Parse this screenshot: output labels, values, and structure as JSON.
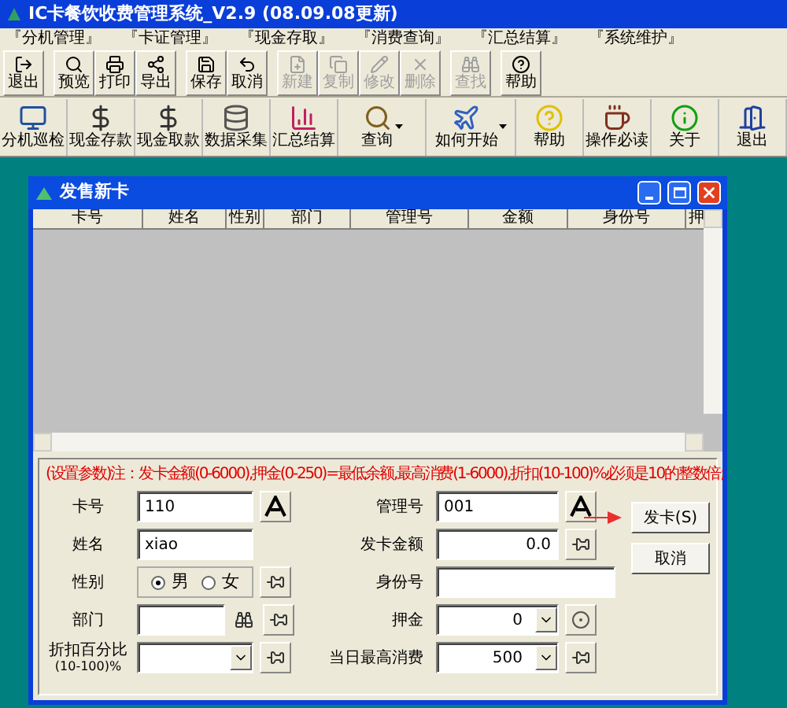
{
  "window": {
    "title": "IC卡餐饮收费管理系统_V2.9 (08.09.08更新)"
  },
  "menu": [
    "『分机管理』",
    "『卡证管理』",
    "『现金存取』",
    "『消费查询』",
    "『汇总结算』",
    "『系统维护』"
  ],
  "toolbar": [
    {
      "label": "退出",
      "disabled": false
    },
    {
      "label": "预览",
      "disabled": false
    },
    {
      "label": "打印",
      "disabled": false
    },
    {
      "label": "导出",
      "disabled": false
    },
    {
      "label": "保存",
      "disabled": false
    },
    {
      "label": "取消",
      "disabled": false
    },
    {
      "label": "新建",
      "disabled": true
    },
    {
      "label": "复制",
      "disabled": true
    },
    {
      "label": "修改",
      "disabled": true
    },
    {
      "label": "删除",
      "disabled": true
    },
    {
      "label": "查找",
      "disabled": true
    },
    {
      "label": "帮助",
      "disabled": false
    }
  ],
  "big_toolbar": [
    {
      "label": "分机巡检",
      "dropdown": false
    },
    {
      "label": "现金存款",
      "dropdown": false
    },
    {
      "label": "现金取款",
      "dropdown": false
    },
    {
      "label": "数据采集",
      "dropdown": false
    },
    {
      "label": "汇总结算",
      "dropdown": false
    },
    {
      "label": "查询",
      "dropdown": true
    },
    {
      "label": "如何开始",
      "dropdown": true
    },
    {
      "label": "帮助",
      "dropdown": false
    },
    {
      "label": "操作必读",
      "dropdown": false
    },
    {
      "label": "关于",
      "dropdown": false
    },
    {
      "label": "退出",
      "dropdown": false
    }
  ],
  "dialog": {
    "title": "发售新卡",
    "table": {
      "columns": [
        "卡号",
        "姓名",
        "性别",
        "部门",
        "管理号",
        "金额",
        "身份号",
        "押"
      ]
    },
    "note": "(设置参数)注：发卡金额(0-6000),押金(0-250)=最低余额,最高消费(1-6000),折扣(10-100)%必须是10的整数倍;",
    "left_fields": [
      {
        "kind": "text",
        "label": "卡号",
        "value": "110",
        "tool": {
          "kind": "font"
        }
      },
      {
        "kind": "text",
        "label": "姓名",
        "value": "xiao"
      },
      {
        "kind": "radio",
        "label": "性别",
        "options": [
          {
            "label": "男",
            "selected": true
          },
          {
            "label": "女",
            "selected": false
          }
        ],
        "tool": {
          "kind": "pin"
        }
      },
      {
        "kind": "search",
        "label": "部门",
        "tool": {
          "kind": "pin"
        }
      },
      {
        "kind": "combo",
        "label": "折扣百分比",
        "label_2": "(10-100)%",
        "tool": {
          "kind": "pin"
        }
      }
    ],
    "right_fields": [
      {
        "kind": "text",
        "label": "管理号",
        "value": "001",
        "tool": {
          "kind": "font"
        }
      },
      {
        "kind": "number",
        "label": "发卡金额",
        "value": "0.0",
        "tool": {
          "kind": "pin"
        }
      },
      {
        "kind": "text",
        "label": "身份号"
      },
      {
        "kind": "combo",
        "label": "押金",
        "value": "0",
        "tool": {
          "kind": "coin"
        }
      },
      {
        "kind": "combo",
        "label": "当日最高消费",
        "value": "500",
        "tool": {
          "kind": "pin"
        }
      }
    ],
    "buttons": [
      "发卡(S)",
      "取消"
    ]
  }
}
